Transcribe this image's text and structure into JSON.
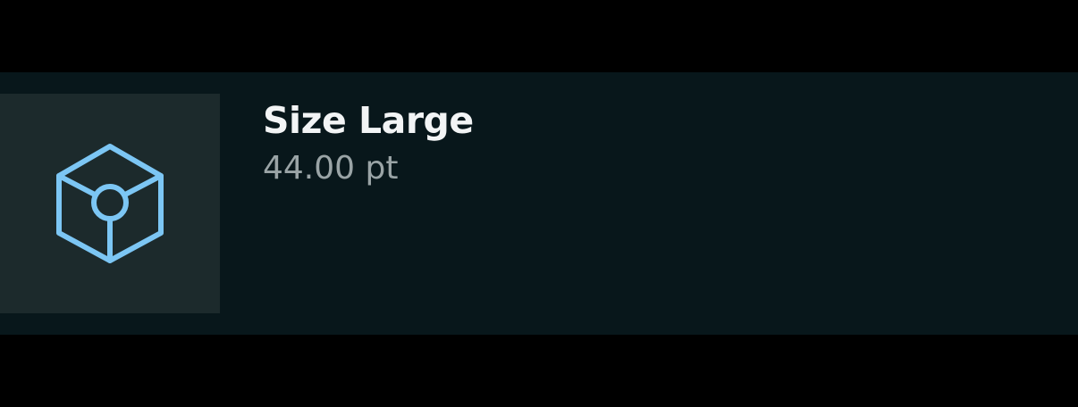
{
  "item": {
    "title": "Size Large",
    "subtitle": "44.00 pt",
    "icon": "cube-icon"
  },
  "colors": {
    "background": "#000000",
    "card_background": "#08171b",
    "thumbnail_background": "#1c2a2c",
    "icon_stroke": "#7cc6f4",
    "title_text": "#f2f4f5",
    "subtitle_text": "#9aa4a6"
  }
}
